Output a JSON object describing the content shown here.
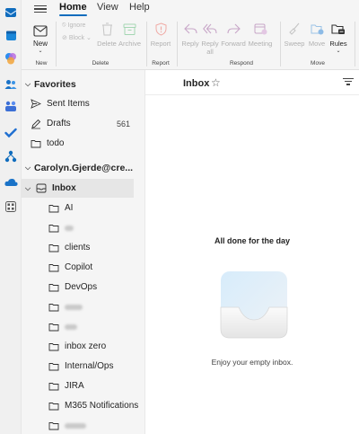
{
  "rail": {
    "icons": [
      "mail-icon",
      "calendar-icon",
      "copilot-icon",
      "people-icon",
      "teams-icon",
      "todo-icon",
      "org-explorer-icon",
      "onedrive-icon",
      "apps-icon"
    ]
  },
  "tabs": [
    {
      "label": "Home",
      "active": true
    },
    {
      "label": "View",
      "active": false
    },
    {
      "label": "Help",
      "active": false
    }
  ],
  "ribbon": {
    "new": {
      "label": "New",
      "group": "New"
    },
    "delete_group": {
      "ignore": "Ignore",
      "block": "Block",
      "delete": "Delete",
      "archive": "Archive",
      "group": "Delete"
    },
    "report_group": {
      "report": "Report",
      "group": "Report"
    },
    "respond_group": {
      "reply": "Reply",
      "reply_all_1": "Reply",
      "reply_all_2": "all",
      "forward": "Forward",
      "meeting": "Meeting",
      "group": "Respond"
    },
    "move_group": {
      "sweep": "Sweep",
      "move": "Move",
      "rules": "Rules",
      "group": "Move"
    }
  },
  "folders": {
    "favorites_label": "Favorites",
    "favorites": [
      {
        "name": "Sent Items",
        "icon": "send-icon",
        "count": ""
      },
      {
        "name": "Drafts",
        "icon": "pencil-icon",
        "count": "561"
      },
      {
        "name": "todo",
        "icon": "folder-icon",
        "count": ""
      }
    ],
    "account_label": "Carolyn.Gjerde@cre...",
    "inbox_label": "Inbox",
    "subfolders": [
      {
        "name": "AI"
      },
      {
        "name": ""
      },
      {
        "name": "clients"
      },
      {
        "name": "Copilot"
      },
      {
        "name": "DevOps"
      },
      {
        "name": ""
      },
      {
        "name": ""
      },
      {
        "name": "inbox zero"
      },
      {
        "name": "Internal/Ops"
      },
      {
        "name": "JIRA"
      },
      {
        "name": "M365 Notifications"
      },
      {
        "name": ""
      }
    ]
  },
  "list": {
    "title": "Inbox",
    "empty_title": "All done for the day",
    "empty_subtitle": "Enjoy your empty inbox."
  },
  "colors": {
    "accent": "#0f6cbd",
    "disabled_icon": "#c8a6c8",
    "disabled_text": "#b0b0b0"
  }
}
